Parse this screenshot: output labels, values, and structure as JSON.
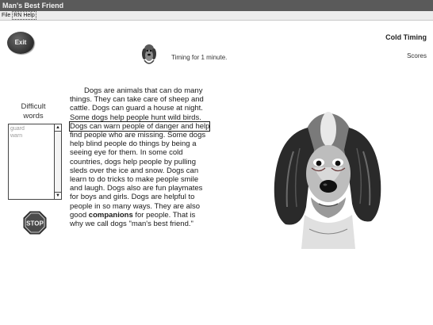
{
  "window": {
    "title": "Man's Best Friend"
  },
  "menu": {
    "items": [
      "File",
      "RN Help"
    ]
  },
  "exit_button": {
    "label": "Exit"
  },
  "timer": {
    "text": "Timing for 1 minute."
  },
  "header": {
    "mode": "Cold Timing",
    "scores_label": "Scores"
  },
  "difficult_words": {
    "label_line1": "Difficult",
    "label_line2": "words",
    "items": [
      "guard",
      "warn"
    ]
  },
  "stop_button": {
    "label": "STOP"
  },
  "passage": {
    "lines": [
      "Dogs are animals that can do many",
      "things.  They can take care of sheep and",
      "cattle.  Dogs can guard a house at night.",
      "Some dogs help people hunt wild birds.",
      "Dogs can warn people of danger and help",
      "find people who are missing.  Some dogs",
      "help blind people do things by being a",
      "seeing eye for them.  In some cold",
      "countries, dogs help people by pulling",
      "sleds over the ice and snow.  Dogs can",
      "learn to do tricks to make people smile",
      "and laugh.  Dogs also are fun playmates",
      "for boys and girls.  Dogs are helpful to",
      "people in so many ways.  They are also"
    ],
    "last_line_prefix": "good ",
    "bold_word": "companions",
    "last_line_suffix": " for people.  That is",
    "final_line": "why we call dogs \"man's best friend.\""
  },
  "colors": {
    "title_bar": "#5a5a5a",
    "menu_bar": "#ececec",
    "exit_button": "#3a3a3a",
    "stop_sign": "#4a4a4a"
  },
  "icons": {
    "exit": "exit-button",
    "timer": "dog-icon",
    "stop": "stop-sign-icon",
    "picture": "basset-hound-picture"
  }
}
